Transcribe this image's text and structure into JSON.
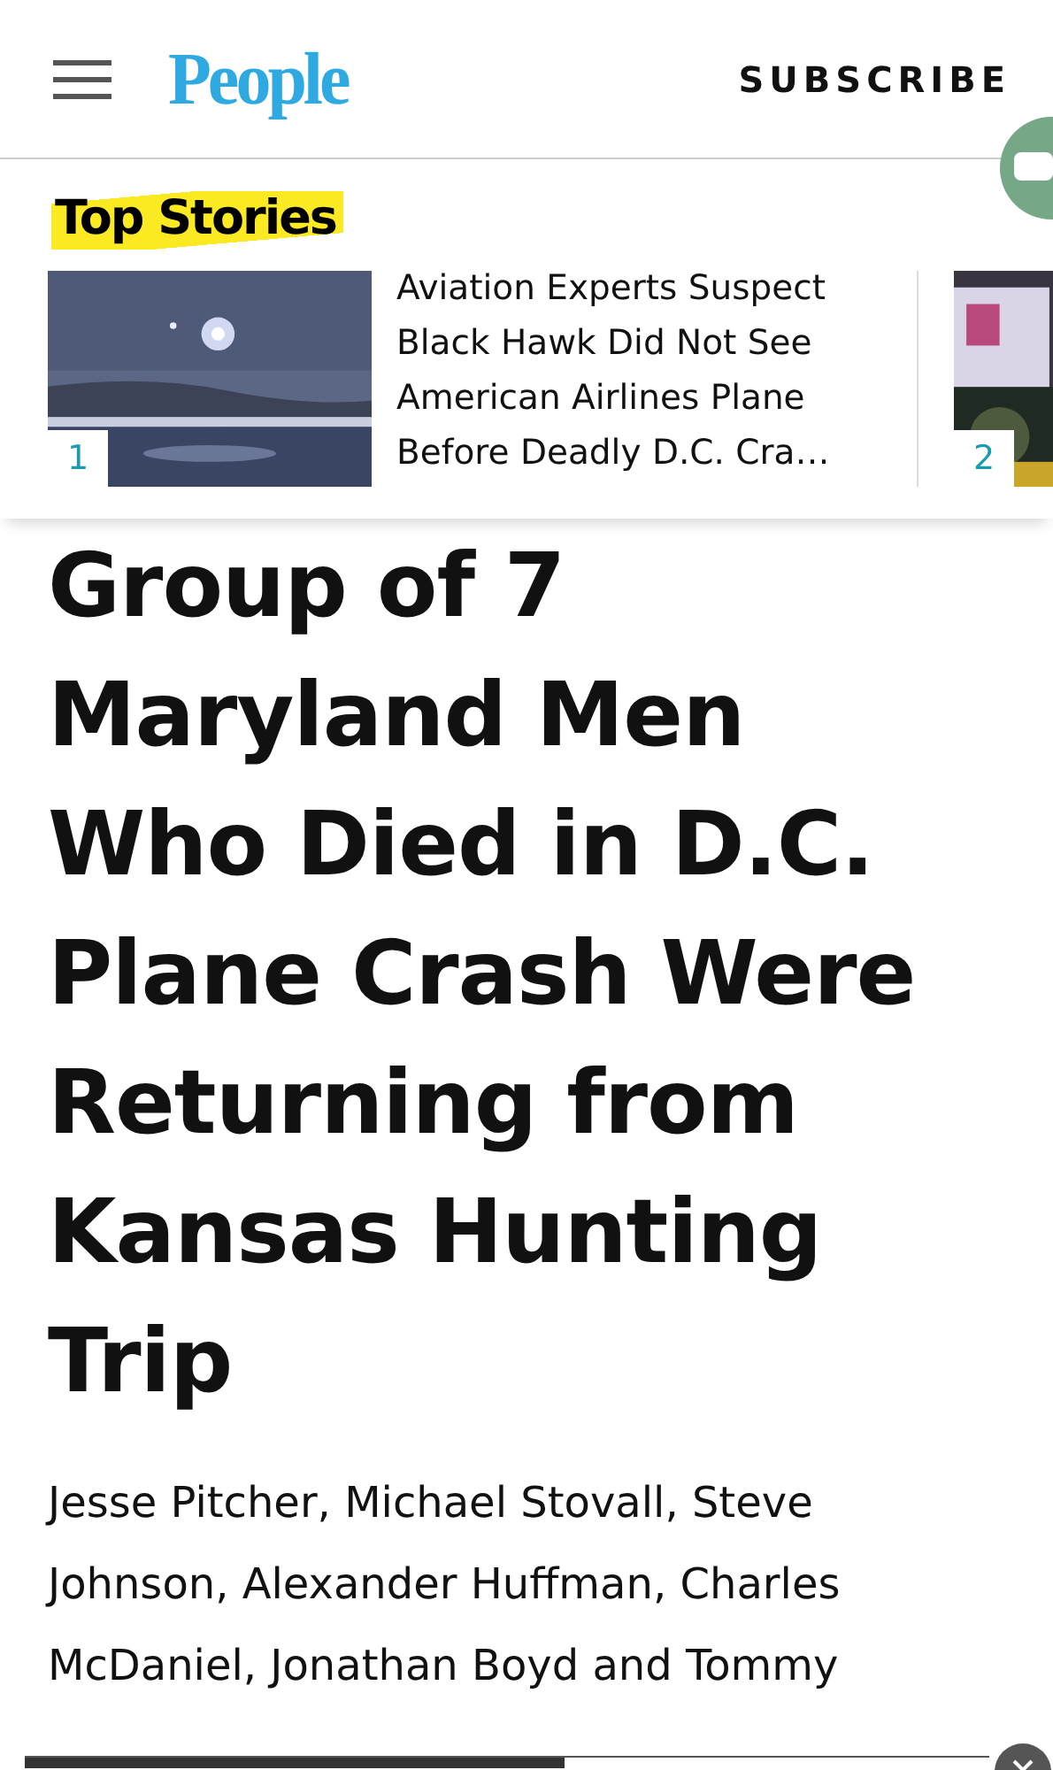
{
  "header": {
    "logo": "People",
    "subscribe": "SUBSCRIBE"
  },
  "top_stories": {
    "heading": "Top Stories",
    "stories": [
      {
        "number": "1",
        "title": "Aviation Experts Suspect Black Hawk Did Not See American Airlines Plane Before Deadly D.C. Cra…"
      },
      {
        "number": "2"
      }
    ]
  },
  "article": {
    "headline": "Group of 7 Maryland Men Who Died in D.C. Plane Crash Were Returning from Kansas Hunting Trip",
    "dek": "Jesse Pitcher, Michael Stovall, Steve Johnson, Alexander Huffman, Charles McDaniel, Jonathan Boyd and Tommy"
  },
  "reading_progress": {
    "level": 0.56
  }
}
